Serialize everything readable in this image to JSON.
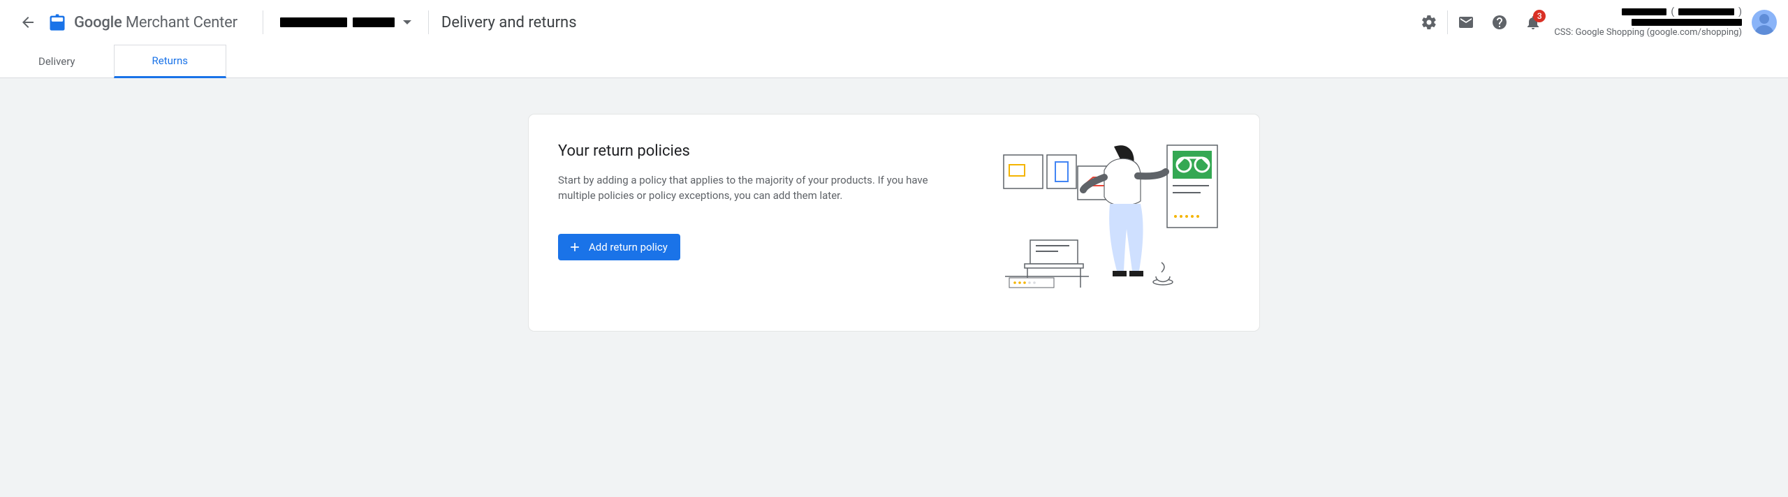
{
  "header": {
    "brand_html_strong": "Google",
    "brand_html_light": " Merchant Center",
    "page_title": "Delivery and returns",
    "notification_count": "3",
    "css_line": "CSS: Google Shopping (google.com/shopping)"
  },
  "tabs": {
    "delivery": "Delivery",
    "returns": "Returns"
  },
  "card": {
    "title": "Your return policies",
    "body": "Start by adding a policy that applies to the majority of your products. If you have multiple policies or policy exceptions, you can add them later.",
    "button": "Add return policy"
  }
}
